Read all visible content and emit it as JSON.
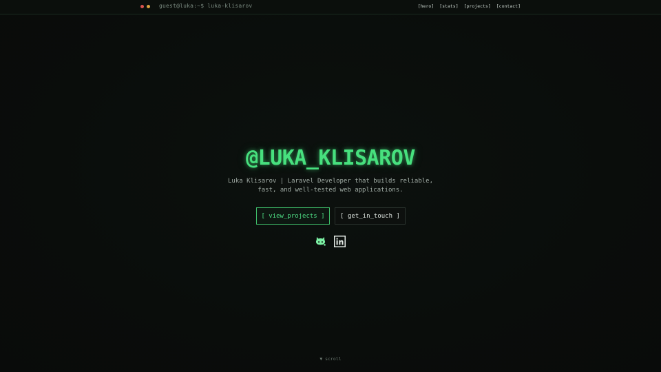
{
  "topbar": {
    "dots": [
      {
        "name": "red",
        "color": "#d9534f"
      },
      {
        "name": "yellow",
        "color": "#d9a23f"
      }
    ],
    "prompt": "guest@luka:~$ luka-klisarov",
    "nav": [
      {
        "label": "[hero]"
      },
      {
        "label": "[stats]"
      },
      {
        "label": "[projects]"
      },
      {
        "label": "[contact]"
      }
    ]
  },
  "hero": {
    "title": "@LUKA_KLISAROV",
    "subtitle": "Luka Klisarov | Laravel Developer that builds reliable, fast, and well-tested web applications.",
    "primary_button": "[ view_projects ]",
    "secondary_button": "[ get_in_touch ]",
    "social": [
      {
        "icon": "github-icon"
      },
      {
        "icon": "linkedin-icon"
      }
    ]
  },
  "scroll_hint": "▼ scroll",
  "colors": {
    "accent": "#47e07e",
    "background": "#0a0d0b"
  }
}
